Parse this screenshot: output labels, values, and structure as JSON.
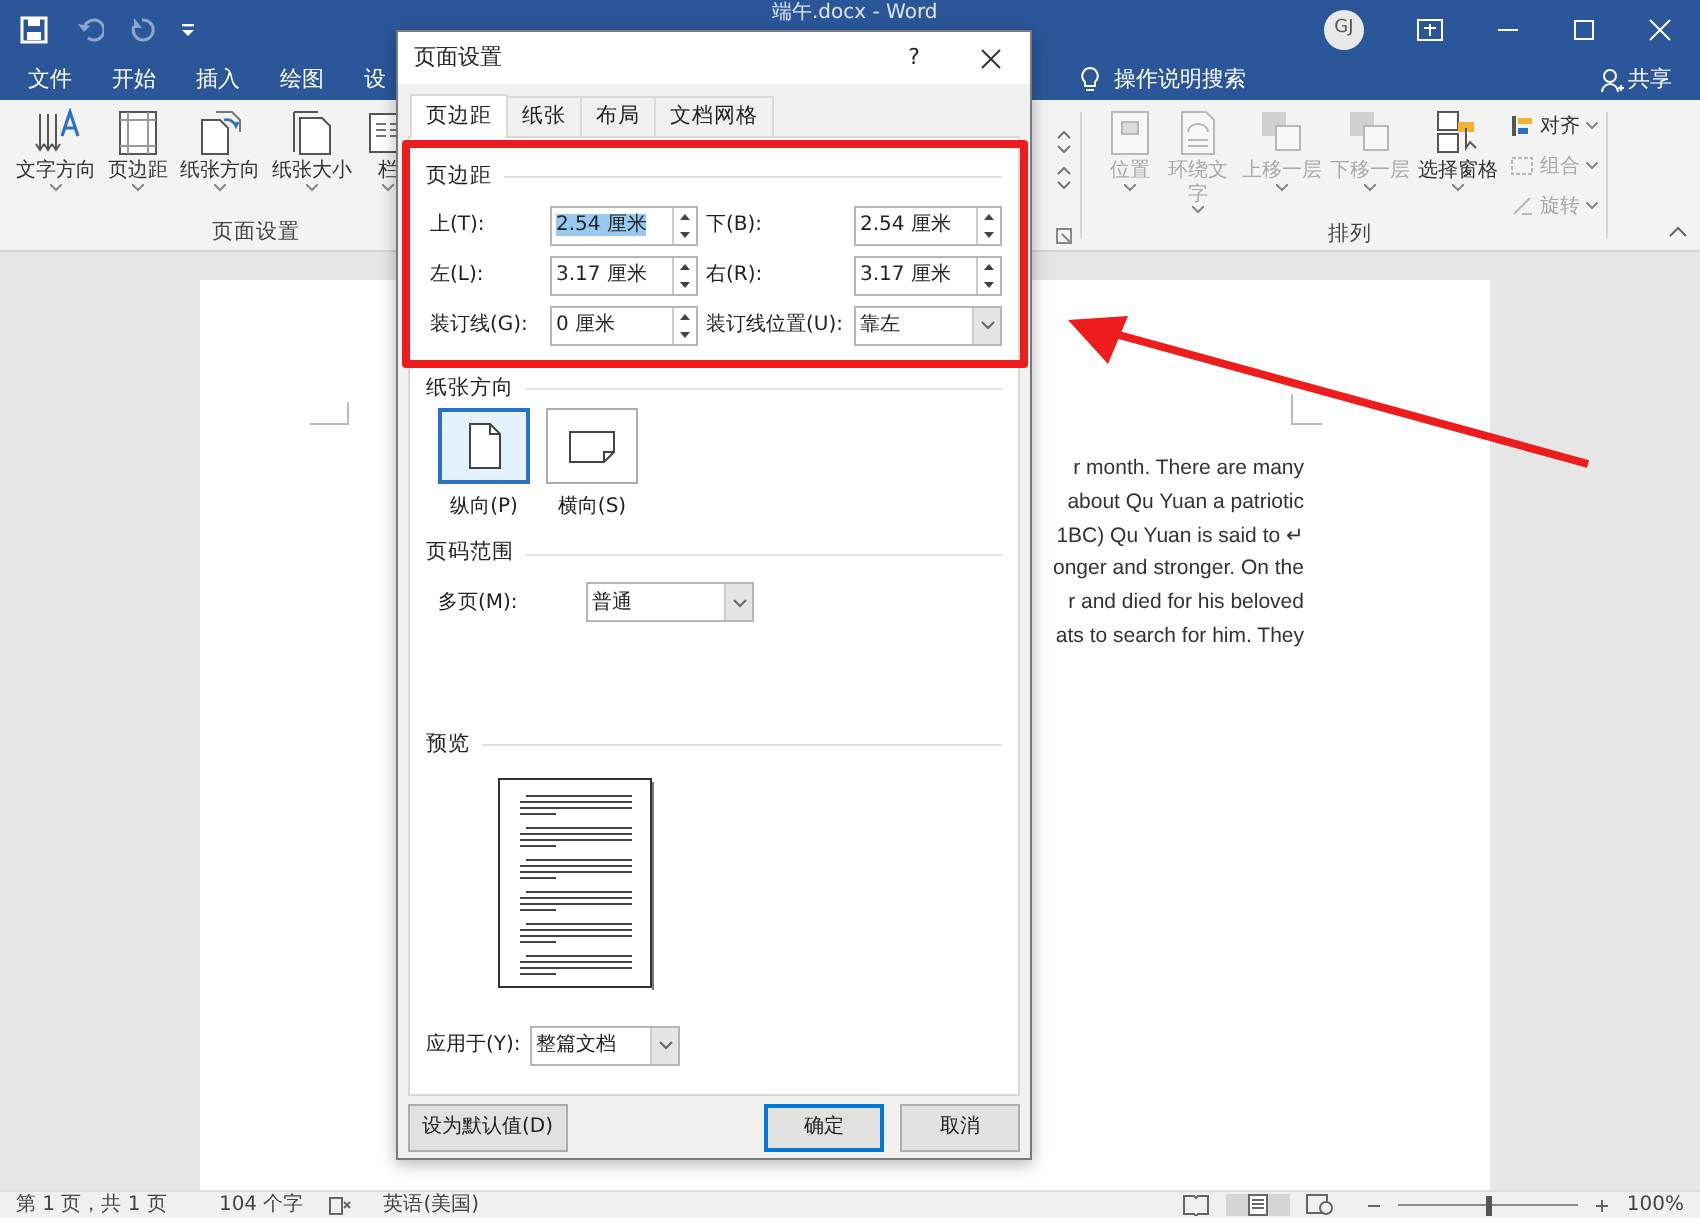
{
  "title_bar": {
    "title": "端午.docx - Word",
    "avatar": "GJ"
  },
  "ribbon_tabs": [
    {
      "label": "文件"
    },
    {
      "label": "开始"
    },
    {
      "label": "插入"
    },
    {
      "label": "绘图"
    },
    {
      "label": "设"
    }
  ],
  "tell_me": "操作说明搜索",
  "share": "共享",
  "ribbon_groups": [
    {
      "label": "页面设置",
      "buttons": [
        {
          "label": "文字方向",
          "disabled": false
        },
        {
          "label": "页边距",
          "disabled": false
        },
        {
          "label": "纸张方向",
          "disabled": false
        },
        {
          "label": "纸张大小",
          "disabled": false
        },
        {
          "label": "栏",
          "disabled": false
        }
      ]
    },
    {
      "label": "排列",
      "buttons": [
        {
          "label": "位置",
          "disabled": true
        },
        {
          "label": "环绕文字",
          "disabled": true
        },
        {
          "label": "上移一层",
          "disabled": true
        },
        {
          "label": "下移一层",
          "disabled": true
        },
        {
          "label": "选择窗格",
          "disabled": false
        }
      ],
      "small_buttons": [
        {
          "label": "对齐",
          "disabled": false
        },
        {
          "label": "组合",
          "disabled": true
        },
        {
          "label": "旋转",
          "disabled": true
        }
      ]
    }
  ],
  "document": {
    "lines": [
      "r month. There are many",
      "about Qu Yuan a patriotic",
      "1BC) Qu Yuan is said to ↵",
      "onger and stronger. On the",
      "r and died for his beloved",
      "ats to search for him. They"
    ]
  },
  "dialog": {
    "title": "页面设置",
    "help": "?",
    "tabs": [
      {
        "label": "页边距",
        "selected": true
      },
      {
        "label": "纸张",
        "selected": false
      },
      {
        "label": "布局",
        "selected": false
      },
      {
        "label": "文档网格",
        "selected": false
      }
    ],
    "margins": {
      "legend": "页边距",
      "fields": [
        {
          "label": "上(T):",
          "value": "2.54 厘米",
          "kind": "spin",
          "text_selected": true
        },
        {
          "label": "下(B):",
          "value": "2.54 厘米",
          "kind": "spin",
          "text_selected": false
        },
        {
          "label": "左(L):",
          "value": "3.17 厘米",
          "kind": "spin",
          "text_selected": false
        },
        {
          "label": "右(R):",
          "value": "3.17 厘米",
          "kind": "spin",
          "text_selected": false
        },
        {
          "label": "装订线(G):",
          "value": "0 厘米",
          "kind": "spin",
          "text_selected": false
        },
        {
          "label": "装订线位置(U):",
          "value": "靠左",
          "kind": "select",
          "text_selected": false
        }
      ]
    },
    "orientation": {
      "legend": "纸张方向",
      "options": [
        {
          "label": "纵向(P)",
          "selected": true
        },
        {
          "label": "横向(S)",
          "selected": false
        }
      ]
    },
    "pages": {
      "legend": "页码范围",
      "label": "多页(M):",
      "value": "普通"
    },
    "preview": {
      "legend": "预览",
      "apply_label": "应用于(Y):",
      "apply_value": "整篇文档"
    },
    "buttons": [
      {
        "label": "设为默认值(D)",
        "kind": "secondary"
      },
      {
        "label": "确定",
        "kind": "default"
      },
      {
        "label": "取消",
        "kind": "secondary"
      }
    ]
  },
  "status_bar": {
    "items": [
      "第 1 页，共 1 页",
      "104 个字",
      "英语(美国)"
    ],
    "zoom": "100%",
    "zoom_slider": {
      "level": 0.5
    }
  }
}
